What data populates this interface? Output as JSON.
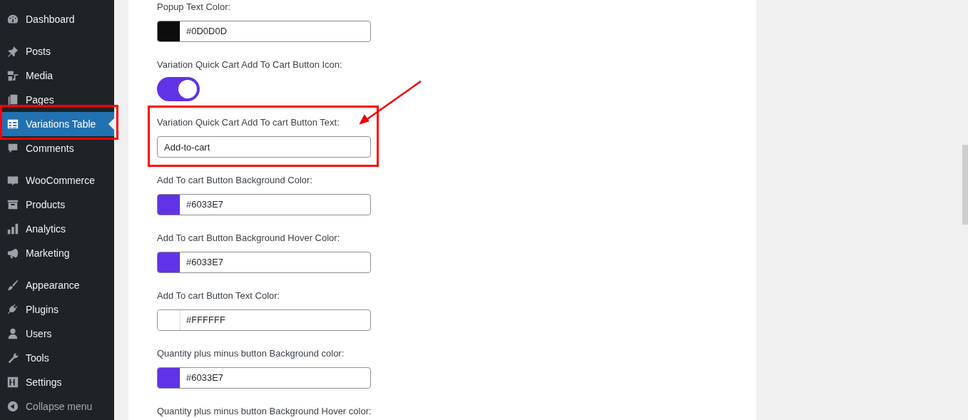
{
  "sidebar": {
    "items": [
      {
        "label": "Dashboard",
        "selected": false,
        "highlighted": false
      },
      {
        "label": "Posts",
        "selected": false,
        "highlighted": false
      },
      {
        "label": "Media",
        "selected": false,
        "highlighted": false
      },
      {
        "label": "Pages",
        "selected": false,
        "highlighted": false
      },
      {
        "label": "Variations Table",
        "selected": true,
        "highlighted": true
      },
      {
        "label": "Comments",
        "selected": false,
        "highlighted": false
      },
      {
        "label": "WooCommerce",
        "selected": false,
        "highlighted": false
      },
      {
        "label": "Products",
        "selected": false,
        "highlighted": false
      },
      {
        "label": "Analytics",
        "selected": false,
        "highlighted": false
      },
      {
        "label": "Marketing",
        "selected": false,
        "highlighted": false
      },
      {
        "label": "Appearance",
        "selected": false,
        "highlighted": false
      },
      {
        "label": "Plugins",
        "selected": false,
        "highlighted": false
      },
      {
        "label": "Users",
        "selected": false,
        "highlighted": false
      },
      {
        "label": "Tools",
        "selected": false,
        "highlighted": false
      },
      {
        "label": "Settings",
        "selected": false,
        "highlighted": false
      },
      {
        "label": "Collapse menu",
        "selected": false,
        "highlighted": false
      }
    ]
  },
  "settings": [
    {
      "kind": "color",
      "label": "Popup Text Color:",
      "value": "#0D0D0D",
      "color": "#0d0d0d",
      "highlighted": false
    },
    {
      "kind": "toggle",
      "label": "Variation Quick Cart Add To Cart Button Icon:",
      "on": true,
      "highlighted": false
    },
    {
      "kind": "text",
      "label": "Variation Quick Cart Add To cart Button Text:",
      "value": "Add-to-cart",
      "highlighted": true
    },
    {
      "kind": "color",
      "label": "Add To cart Button Background Color:",
      "value": "#6033E7",
      "color": "#6033e7",
      "highlighted": false
    },
    {
      "kind": "color",
      "label": "Add To cart Button Background Hover Color:",
      "value": "#6033E7",
      "color": "#6033e7",
      "highlighted": false
    },
    {
      "kind": "color",
      "label": "Add To cart Button Text Color:",
      "value": "#FFFFFF",
      "color": "#ffffff",
      "highlighted": false
    },
    {
      "kind": "color",
      "label": "Quantity plus minus button Background color:",
      "value": "#6033E7",
      "color": "#6033e7",
      "highlighted": false
    },
    {
      "kind": "color",
      "label": "Quantity plus minus button Background Hover color:",
      "highlighted": false
    }
  ]
}
